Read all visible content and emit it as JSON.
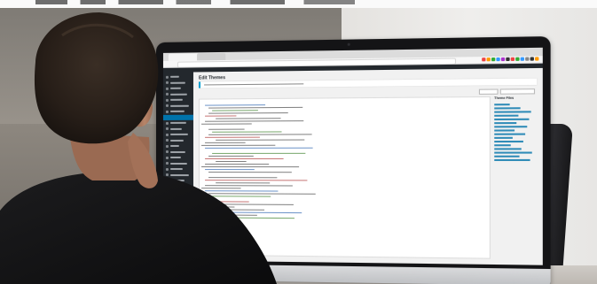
{
  "scene": {
    "description_colors": {
      "wall_left": "#8a857e",
      "wall_right": "#ecebe9",
      "monitor_bezel": "#141416",
      "admin_sidebar": "#23282d",
      "accent_blue": "#0073aa",
      "shirt": "#111111",
      "hair": "#2a211b",
      "skin": "#b07e62"
    }
  },
  "monitor": {
    "browser": {
      "tabs": [
        "",
        ""
      ],
      "extension_colors": [
        "#e44",
        "#f90",
        "#3a3",
        "#39f",
        "#a3c",
        "#333",
        "#e44",
        "#3a3",
        "#39f",
        "#888",
        "#333",
        "#f90"
      ]
    },
    "wordpress": {
      "page_title": "Edit Themes",
      "subtitle": "",
      "files_title": "Theme Files",
      "sidebar_item_count": 24
    }
  }
}
